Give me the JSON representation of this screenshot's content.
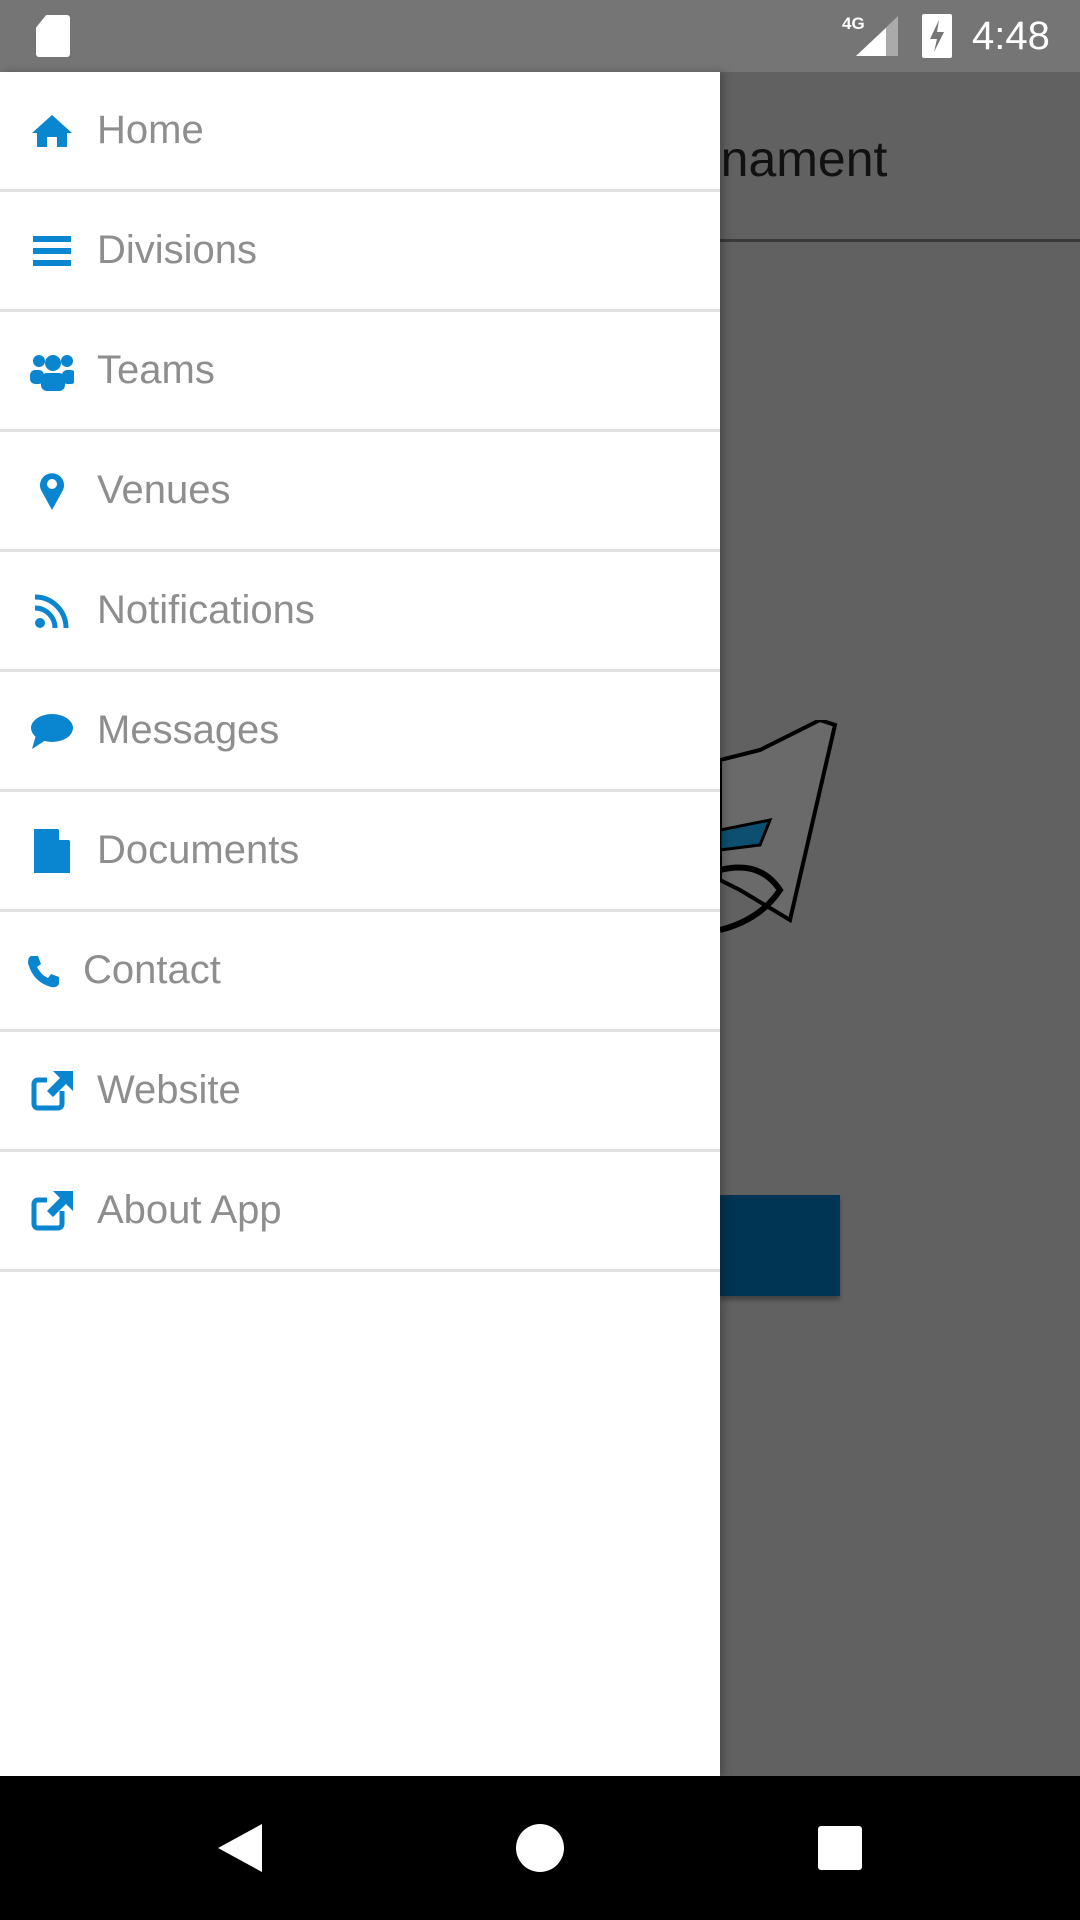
{
  "status_bar": {
    "network": "4G",
    "time": "4:48",
    "icons": [
      "sd-card-icon",
      "signal-icon",
      "battery-charging-icon"
    ]
  },
  "app": {
    "title_partial": "rnament"
  },
  "drawer": {
    "accent": "#0a85cf",
    "items": [
      {
        "label": "Home",
        "icon": "home-icon"
      },
      {
        "label": "Divisions",
        "icon": "list-icon"
      },
      {
        "label": "Teams",
        "icon": "users-icon"
      },
      {
        "label": "Venues",
        "icon": "map-marker-icon"
      },
      {
        "label": "Notifications",
        "icon": "rss-icon"
      },
      {
        "label": "Messages",
        "icon": "chat-bubble-icon"
      },
      {
        "label": "Documents",
        "icon": "file-icon"
      },
      {
        "label": "Contact",
        "icon": "phone-icon"
      },
      {
        "label": "Website",
        "icon": "external-link-icon"
      },
      {
        "label": "About App",
        "icon": "external-link-icon"
      }
    ]
  },
  "nav_bar": {
    "buttons": [
      "back",
      "home",
      "recents"
    ]
  }
}
